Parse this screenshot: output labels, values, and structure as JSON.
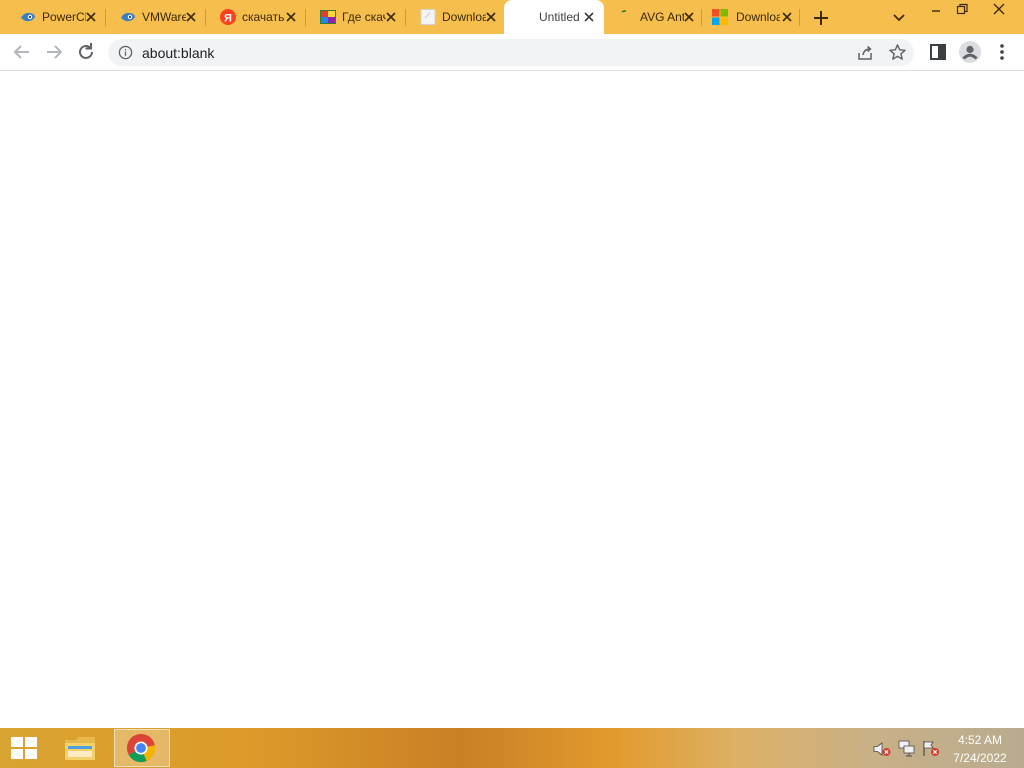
{
  "tabs": [
    {
      "title": "PowerCLI Documentation",
      "icon": "vmware-tech-docs-icon",
      "active": false
    },
    {
      "title": "VMWare Docs",
      "icon": "vmware-tech-docs-icon",
      "active": false
    },
    {
      "title": "скачать",
      "icon": "yandex-icon",
      "active": false
    },
    {
      "title": "Где скачать",
      "icon": "colorful-image-icon",
      "active": false
    },
    {
      "title": "Download",
      "icon": "blank-page-icon",
      "active": false
    },
    {
      "title": "Untitled",
      "icon": "",
      "active": true
    },
    {
      "title": "AVG AntiVirus",
      "icon": "loading-icon",
      "active": false
    },
    {
      "title": "Download",
      "icon": "microsoft-logo-icon",
      "active": false
    }
  ],
  "omnibox": {
    "url": "about:blank",
    "icon": "info-icon"
  },
  "taskbar": {
    "time": "4:52 AM",
    "date": "7/24/2022"
  },
  "colors": {
    "frame": "#f6be4c",
    "toolbar": "#ffffff",
    "omnibox": "#f1f3f4",
    "page": "#ffffff"
  }
}
